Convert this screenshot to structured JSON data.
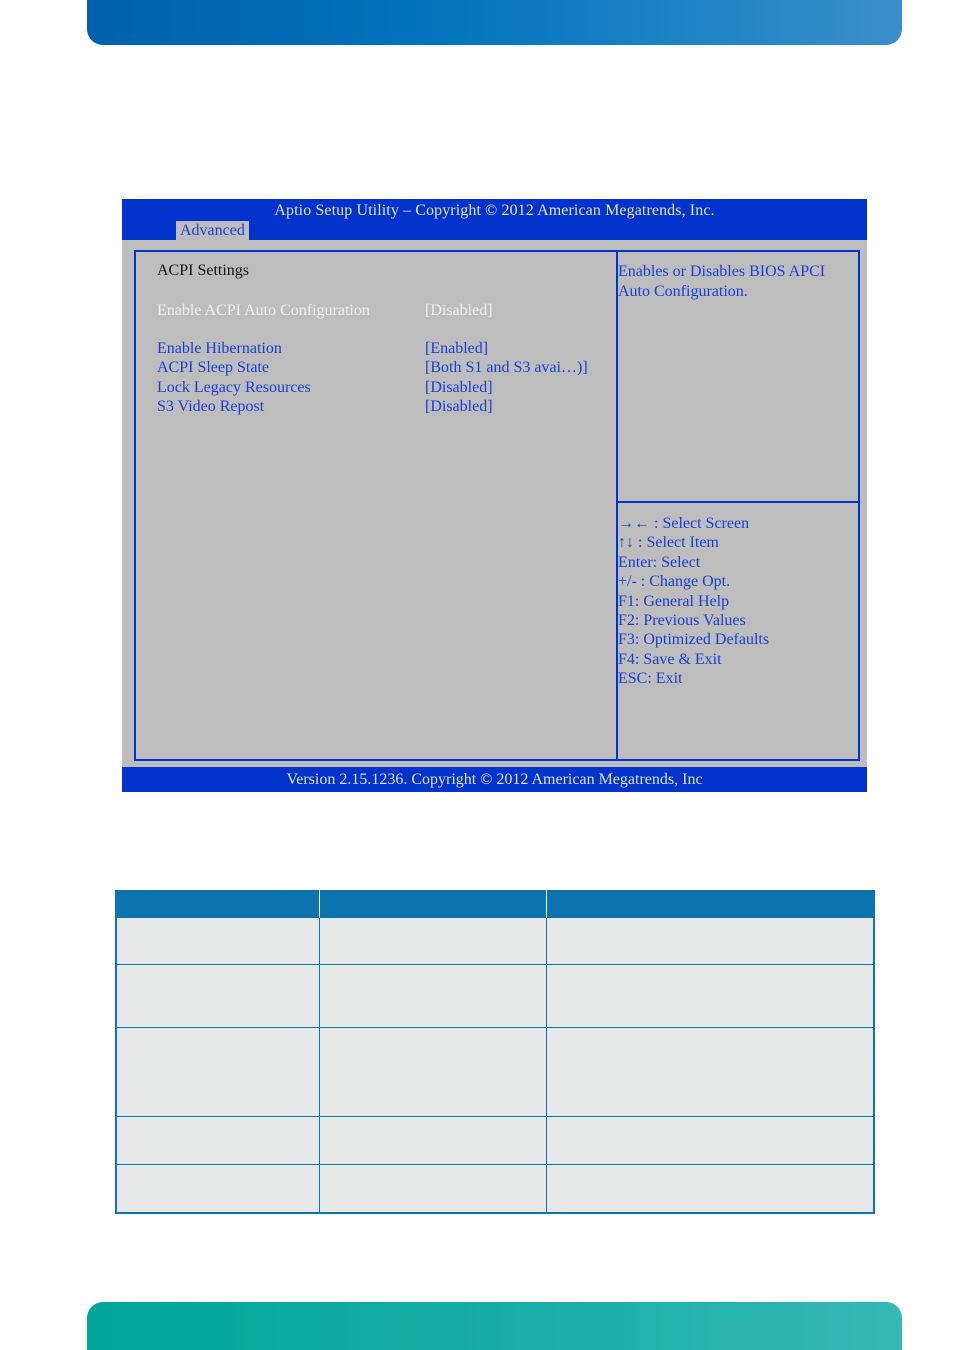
{
  "bios": {
    "title": "Aptio Setup Utility  –  Copyright © 2012 American Megatrends, Inc.",
    "active_tab": "Advanced",
    "section_title": "ACPI Settings",
    "settings": [
      {
        "label": "Enable ACPI Auto Configuration",
        "value": "[Disabled]",
        "state": "disabled"
      },
      {
        "label": "Enable Hibernation",
        "value": "[Enabled]",
        "state": "active"
      },
      {
        "label": "ACPI Sleep State",
        "value": "[Both S1 and S3 avai…)]",
        "state": "active"
      },
      {
        "label": "Lock Legacy Resources",
        "value": "[Disabled]",
        "state": "active"
      },
      {
        "label": "S3 Video Repost",
        "value": "[Disabled]",
        "state": "active"
      }
    ],
    "help_text": "Enables or Disables BIOS APCI Auto Configuration.",
    "key_hints": [
      "→← : Select Screen",
      "↑↓ : Select Item",
      "Enter: Select",
      "+/- : Change Opt.",
      "F1: General Help",
      "F2: Previous Values",
      "F3: Optimized Defaults",
      "F4: Save & Exit",
      "ESC: Exit"
    ],
    "footer": "Version 2.15.1236. Copyright © 2012 American Megatrends, Inc",
    "colors": {
      "frame_blue": "#0033cc",
      "background_gray": "#bdbdbd",
      "active_text": "#1a3fd0",
      "disabled_text": "#eeeeee"
    }
  },
  "table": {
    "headers": [
      "",
      "",
      ""
    ],
    "rows": [
      [
        "",
        "",
        ""
      ],
      [
        "",
        "",
        ""
      ],
      [
        "",
        "",
        ""
      ],
      [
        "",
        "",
        ""
      ],
      [
        "",
        "",
        ""
      ]
    ],
    "colors": {
      "header": "#0e74b0",
      "cell": "#e7e9e9"
    }
  },
  "page": {
    "colors": {
      "top_banner": "#0072bb",
      "bottom_banner": "#17ada6"
    }
  }
}
